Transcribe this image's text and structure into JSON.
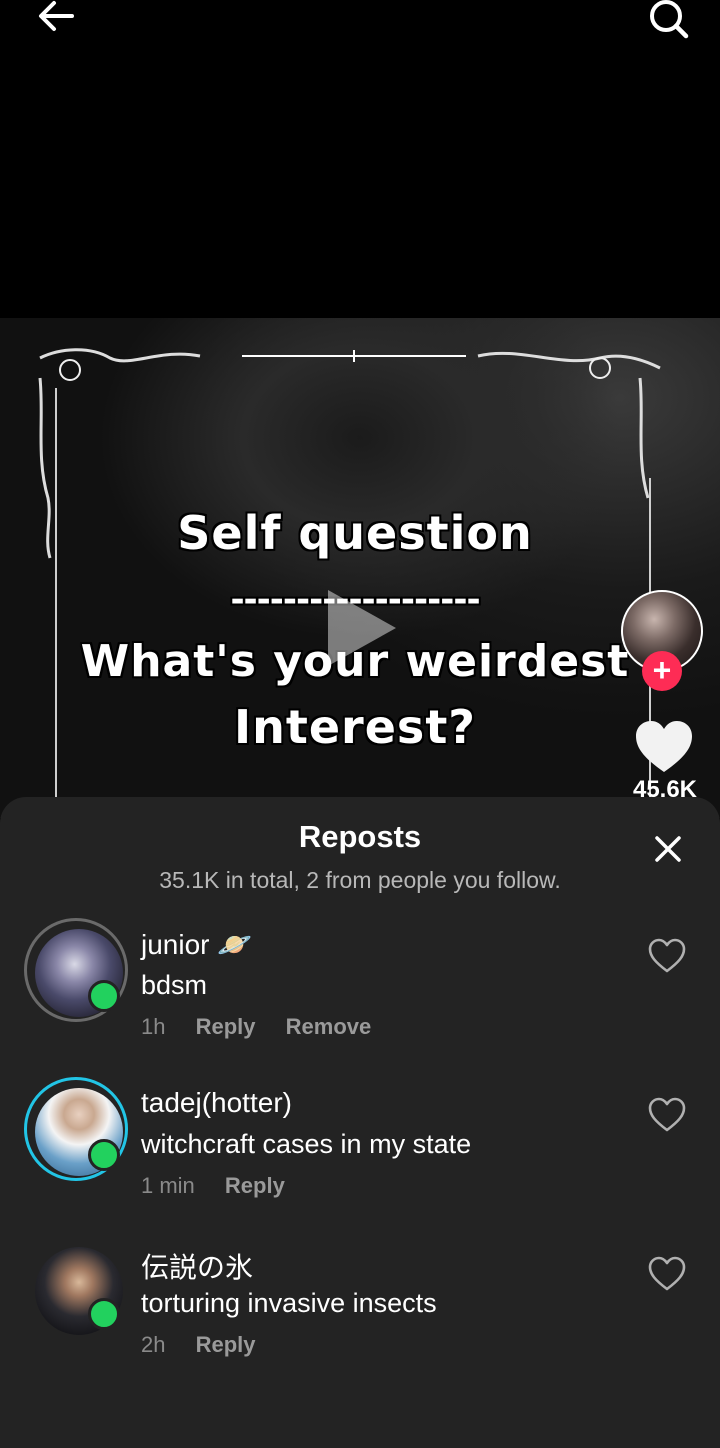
{
  "video": {
    "line1": "Self question",
    "line2": "-------------------",
    "line3": "What's your weirdest",
    "line4": "Interest?",
    "like_count": "45.6K"
  },
  "sheet": {
    "title": "Reposts",
    "subtitle": "35.1K in total, 2 from people you follow."
  },
  "comments": [
    {
      "name": "junior 🪐",
      "text": "bdsm",
      "time": "1h",
      "reply": "Reply",
      "remove": "Remove"
    },
    {
      "name": "tadej(hotter)",
      "text": "witchcraft cases in my state",
      "time": "1 min",
      "reply": "Reply"
    },
    {
      "name": "伝説の氷",
      "text": "torturing invasive insects",
      "time": "2h",
      "reply": "Reply"
    }
  ],
  "colors": {
    "accent": "#fe2c55",
    "online": "#22d15e",
    "story_ring": "#22c5e6",
    "sheet_bg": "#232323"
  }
}
